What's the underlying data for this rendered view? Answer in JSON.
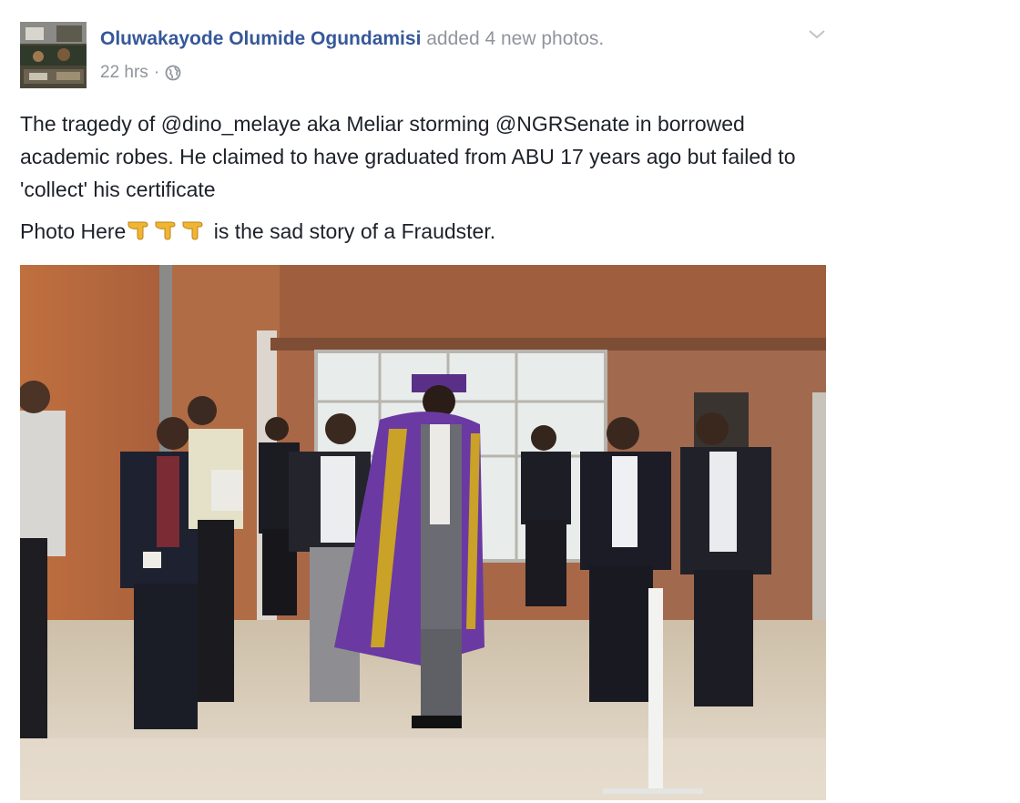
{
  "post": {
    "author": "Oluwakayode Olumide Ogundamisi",
    "action": "added 4 new photos.",
    "time": "22 hrs",
    "separator": "·",
    "privacy_icon": "globe-icon",
    "menu_icon": "chevron-down-icon",
    "text_line1": "The tragedy of @dino_melaye aka Meliar storming @NGRSenate in borrowed academic robes. He claimed to have graduated from ABU 17 years ago but failed to 'collect' his certificate",
    "text_line2_start": "Photo Here",
    "text_line2_end": " is the sad story of a Fraudster.",
    "emoji_icon": "backhand-index-pointing-down-icon"
  },
  "colors": {
    "author_link": "#365899",
    "meta_grey": "#90949c",
    "body_text": "#1d2129",
    "robe_purple": "#6a3aa2",
    "robe_gold": "#c9a227",
    "wall_wood": "#b56a42"
  }
}
